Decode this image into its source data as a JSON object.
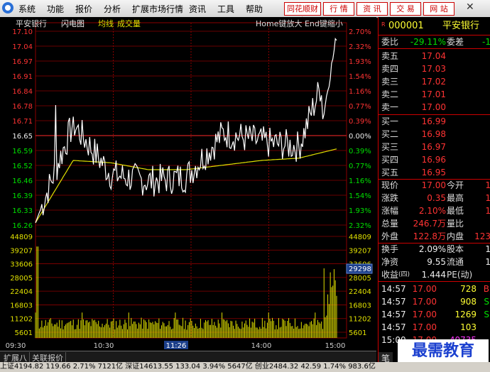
{
  "menubar": {
    "items": [
      "系统",
      "功能",
      "报价",
      "分析",
      "扩展市场行情",
      "资讯",
      "工具",
      "帮助"
    ],
    "buttons": [
      "同花顺财富",
      "行 情",
      "资 讯",
      "交 易",
      "网 站"
    ]
  },
  "chart": {
    "stock_name": "平安银行",
    "tabs": [
      "闪电图",
      "均线",
      "成交量"
    ],
    "hint": "Home键放大 End键缩小",
    "price_labels": [
      "17.10",
      "17.04",
      "16.97",
      "16.91",
      "16.84",
      "16.78",
      "16.71",
      "16.65",
      "16.59",
      "16.52",
      "16.46",
      "16.39",
      "16.33",
      "16.26"
    ],
    "pct_labels": [
      "2.70%",
      "2.32%",
      "1.93%",
      "1.54%",
      "1.16%",
      "0.77%",
      "0.39%",
      "0.00%",
      "0.39%",
      "0.77%",
      "1.16%",
      "1.54%",
      "1.93%",
      "2.32%"
    ],
    "volume_labels": [
      "44809",
      "39207",
      "33606",
      "28005",
      "22404",
      "16803",
      "11202",
      "5601"
    ],
    "time_labels": [
      "09:30",
      "10:30",
      "11:26",
      "14:00",
      "15:00"
    ],
    "cursor_volume": "29298"
  },
  "chart_data": {
    "type": "line",
    "title": "平安银行",
    "ylim": [
      16.26,
      17.1
    ],
    "pre_close": 16.65,
    "series": [
      {
        "name": "均线",
        "color": "#e0e000"
      },
      {
        "name": "闪电图",
        "color": "#ffffff"
      }
    ],
    "x": [
      "09:30",
      "10:00",
      "10:30",
      "11:00",
      "11:26",
      "13:30",
      "14:00",
      "14:30",
      "15:00"
    ],
    "price": [
      16.27,
      16.7,
      16.48,
      16.45,
      16.47,
      16.66,
      16.62,
      16.6,
      17.05
    ],
    "avg": [
      16.27,
      16.54,
      16.53,
      16.5,
      16.5,
      16.52,
      16.54,
      16.55,
      16.59
    ],
    "volume_ylim": [
      0,
      44809
    ]
  },
  "panel": {
    "code": "000001",
    "name": "平安银行",
    "badge": "R",
    "weibi_label": "委比",
    "weibi_value": "-29.11%",
    "weicha_label": "委差",
    "weicha_value": "-1",
    "asks": [
      {
        "label": "卖五",
        "price": "17.04"
      },
      {
        "label": "卖四",
        "price": "17.03"
      },
      {
        "label": "卖三",
        "price": "17.02"
      },
      {
        "label": "卖二",
        "price": "17.01"
      },
      {
        "label": "卖一",
        "price": "17.00"
      }
    ],
    "bids": [
      {
        "label": "买一",
        "price": "16.99"
      },
      {
        "label": "买二",
        "price": "16.98"
      },
      {
        "label": "买三",
        "price": "16.97"
      },
      {
        "label": "买四",
        "price": "16.96"
      },
      {
        "label": "买五",
        "price": "16.95"
      }
    ],
    "stats": [
      {
        "l1": "现价",
        "v1": "17.00",
        "l2": "今开",
        "v2": "1"
      },
      {
        "l1": "涨跌",
        "v1": "0.35",
        "l2": "最高",
        "v2": "1"
      },
      {
        "l1": "涨幅",
        "v1": "2.10%",
        "l2": "最低",
        "v2": "1"
      },
      {
        "l1": "总量",
        "v1": "246.7万",
        "l2": "量比",
        "v2": ""
      },
      {
        "l1": "外盘",
        "v1": "122.8万",
        "l2": "内盘",
        "v2": "123"
      }
    ],
    "stats2": [
      {
        "l1": "换手",
        "v1": "2.09%",
        "l2": "股本",
        "v2": "1"
      },
      {
        "l1": "净资",
        "v1": "9.55",
        "l2": "流通",
        "v2": "1"
      },
      {
        "l1": "收益",
        "sub": "(四)",
        "v1": "1.444",
        "l2": "PE(动)",
        "v2": ""
      }
    ],
    "ticks": [
      {
        "time": "14:57",
        "price": "17.00",
        "vol": "728",
        "side": "B"
      },
      {
        "time": "14:57",
        "price": "17.00",
        "vol": "908",
        "side": "S"
      },
      {
        "time": "14:57",
        "price": "17.00",
        "vol": "1269",
        "side": "S"
      },
      {
        "time": "14:57",
        "price": "17.00",
        "vol": "103",
        "side": ""
      },
      {
        "time": "15:00",
        "price": "17.00",
        "vol": "40735",
        "side": ""
      }
    ],
    "bottom_tab": "笔"
  },
  "bottom_tabs": [
    "扩展八",
    "关联报价"
  ],
  "statusbar": "上证4194.82  119.66  2.71%  7121亿  深证14613.55  133.04  3.94%  5647亿  创业2484.32  42.59  1.74%  983.6亿",
  "watermark": "最需教育",
  "colors": {
    "up": "#ff3333",
    "down": "#00e000",
    "avg": "#e0e000",
    "grid": "#8b0000"
  }
}
